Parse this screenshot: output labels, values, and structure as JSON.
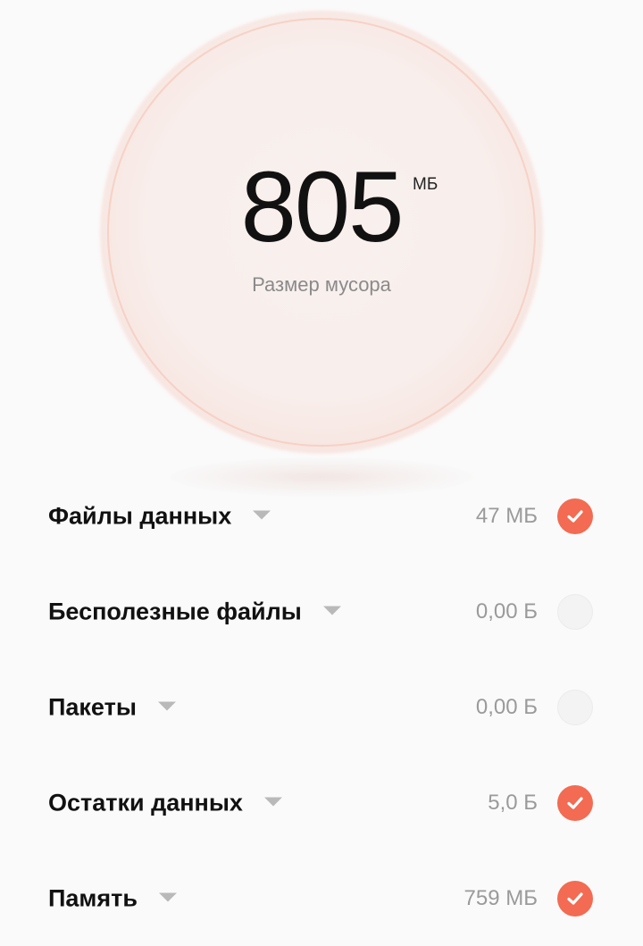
{
  "summary": {
    "value": "805",
    "unit": "МБ",
    "label": "Размер мусора"
  },
  "accent_color": "#f26b52",
  "categories": [
    {
      "label": "Файлы данных",
      "size": "47 МБ",
      "checked": true
    },
    {
      "label": "Бесполезные файлы",
      "size": "0,00 Б",
      "checked": false
    },
    {
      "label": "Пакеты",
      "size": "0,00 Б",
      "checked": false
    },
    {
      "label": "Остатки данных",
      "size": "5,0 Б",
      "checked": true
    },
    {
      "label": "Память",
      "size": "759 МБ",
      "checked": true
    }
  ],
  "icons": {
    "expand": "chevron-down-icon",
    "checkbox_on": "check-icon"
  }
}
